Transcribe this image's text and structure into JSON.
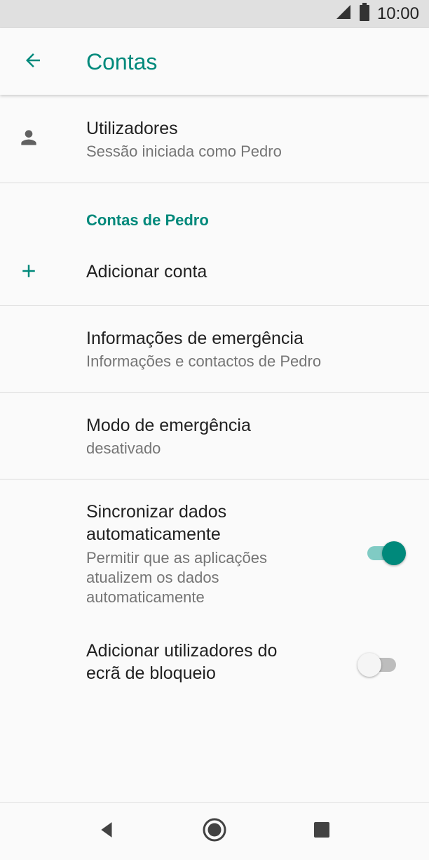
{
  "status_bar": {
    "time": "10:00",
    "signal_icon": "cell-signal-icon",
    "battery_icon": "battery-icon"
  },
  "app_bar": {
    "title": "Contas",
    "back_icon": "arrow-back-icon"
  },
  "colors": {
    "accent": "#00897b",
    "accent_light": "#80cbc4",
    "background": "#fafafa",
    "status_bar": "#e0e0e0"
  },
  "users": {
    "title": "Utilizadores",
    "subtitle": "Sessão iniciada como Pedro",
    "icon": "person-icon"
  },
  "section": {
    "header": "Contas de Pedro"
  },
  "add_account": {
    "label": "Adicionar conta",
    "icon": "plus-icon"
  },
  "emergency_info": {
    "title": "Informações de emergência",
    "subtitle": "Informações e contactos de Pedro"
  },
  "emergency_mode": {
    "title": "Modo de emergência",
    "subtitle": "desativado"
  },
  "auto_sync": {
    "title_line1": "Sincronizar dados",
    "title_line2": "automaticamente",
    "sub_line1": "Permitir que as aplicações",
    "sub_line2": "atualizem os dados",
    "sub_line3": "automaticamente",
    "enabled": true
  },
  "lock_screen_users": {
    "title_line1": "Adicionar utilizadores do",
    "title_line2": "ecrã de bloqueio",
    "enabled": false
  },
  "nav_bar": {
    "back_icon": "nav-back-icon",
    "home_icon": "nav-home-icon",
    "recents_icon": "nav-recents-icon"
  }
}
